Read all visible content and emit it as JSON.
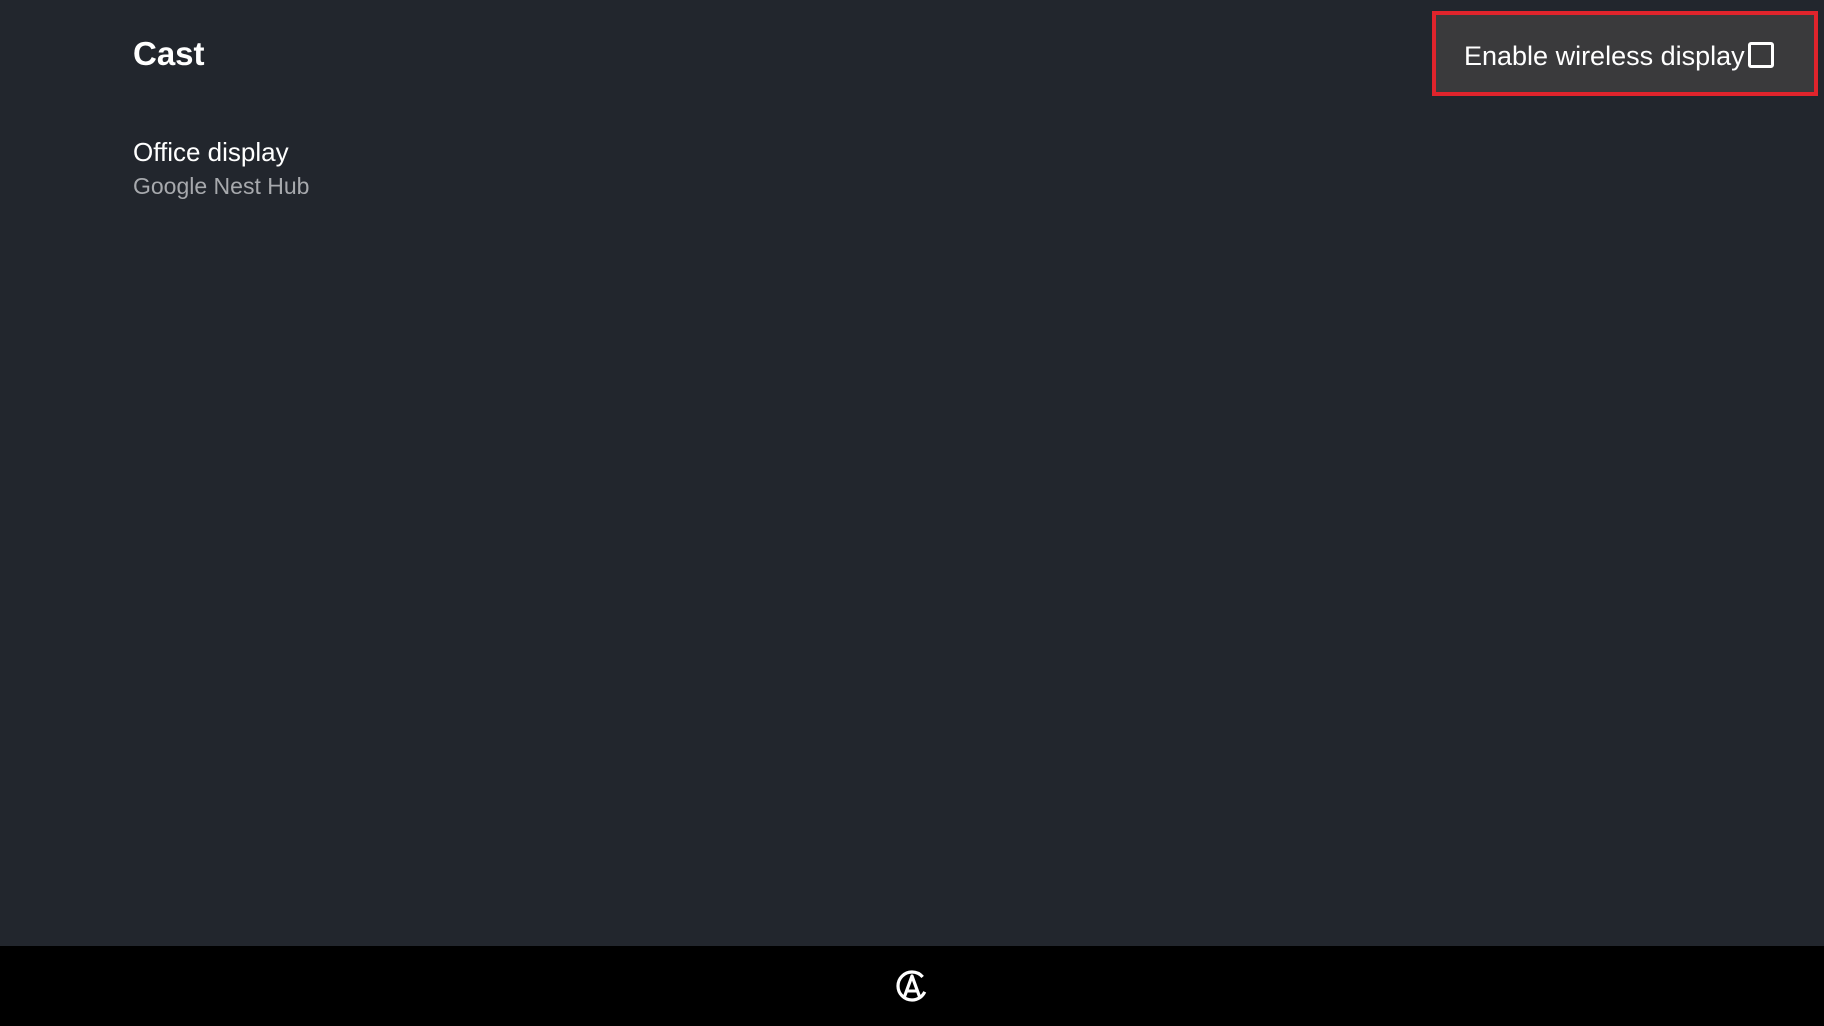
{
  "header": {
    "title": "Cast"
  },
  "wireless_display": {
    "label": "Enable wireless display",
    "checked": false
  },
  "devices": [
    {
      "name": "Office display",
      "model": "Google Nest Hub"
    }
  ],
  "nav_bar": {
    "icon": "launcher-logo-icon"
  },
  "colors": {
    "background": "#22262d",
    "highlight_border": "#e0242c",
    "toggle_background": "#3a3a3c",
    "nav_background": "#000000",
    "secondary_text": "#a7a9ad"
  }
}
